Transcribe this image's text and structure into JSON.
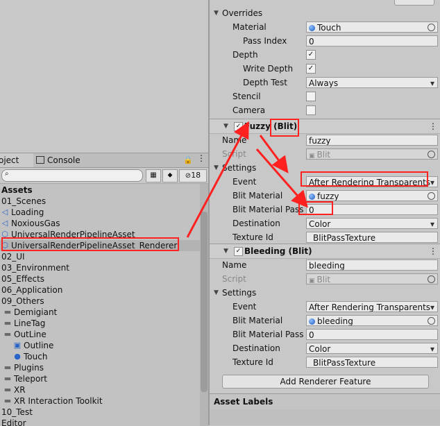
{
  "project": {
    "tabs": [
      {
        "label": "oject"
      },
      {
        "label": "Console"
      }
    ],
    "hidden_count": "18",
    "tree": [
      {
        "label": "Assets",
        "bold": true,
        "icon": "none"
      },
      {
        "label": "01_Scenes",
        "icon": "none"
      },
      {
        "label": "Loading",
        "icon": "unity-scene-icon"
      },
      {
        "label": "NoxiousGas",
        "icon": "unity-scene-icon"
      },
      {
        "label": "UniversalRenderPipelineAsset",
        "icon": "pipeline-asset-icon"
      },
      {
        "label": "UniversalRenderPipelineAsset_Renderer",
        "icon": "pipeline-asset-icon",
        "selected": true
      },
      {
        "label": "02_UI",
        "icon": "none"
      },
      {
        "label": "03_Environment",
        "icon": "none"
      },
      {
        "label": "05_Effects",
        "icon": "none"
      },
      {
        "label": "06_Application",
        "icon": "none"
      },
      {
        "label": "09_Others",
        "icon": "none"
      },
      {
        "label": "Demigiant",
        "icon": "folder-icon"
      },
      {
        "label": "LineTag",
        "icon": "folder-icon"
      },
      {
        "label": "OutLine",
        "icon": "folder-icon"
      },
      {
        "label": "Outline",
        "icon": "script-icon"
      },
      {
        "label": "Touch",
        "icon": "material-icon"
      },
      {
        "label": "Plugins",
        "icon": "folder-icon"
      },
      {
        "label": "Teleport",
        "icon": "folder-icon"
      },
      {
        "label": "XR",
        "icon": "folder-icon"
      },
      {
        "label": "XR Interaction Toolkit",
        "icon": "folder-icon"
      },
      {
        "label": "10_Test",
        "icon": "none"
      },
      {
        "label": "Editor",
        "icon": "none"
      }
    ]
  },
  "inspector": {
    "overrides": {
      "title": "Overrides",
      "material_label": "Material",
      "material_value": "Touch",
      "pass_index_label": "Pass Index",
      "pass_index_value": "0",
      "depth_label": "Depth",
      "write_depth_label": "Write Depth",
      "depth_test_label": "Depth Test",
      "depth_test_value": "Always",
      "stencil_label": "Stencil",
      "camera_label": "Camera"
    },
    "fuzzy": {
      "title": "Fuzzy (Blit)",
      "name_label": "Name",
      "name_value": "fuzzy",
      "script_label": "Script",
      "script_value": "Blit",
      "settings_label": "Settings",
      "event_label": "Event",
      "event_value": "After Rendering Transparents",
      "blit_material_label": "Blit Material",
      "blit_material_value": "fuzzy",
      "pass_label": "Blit Material Pass I",
      "pass_value": "0",
      "destination_label": "Destination",
      "destination_value": "Color",
      "texture_label": "Texture Id",
      "texture_value": "_BlitPassTexture"
    },
    "bleeding": {
      "title": "Bleeding (Blit)",
      "name_label": "Name",
      "name_value": "bleeding",
      "script_label": "Script",
      "script_value": "Blit",
      "settings_label": "Settings",
      "event_label": "Event",
      "event_value": "After Rendering Transparents",
      "blit_material_label": "Blit Material",
      "blit_material_value": "bleeding",
      "pass_label": "Blit Material Pass I",
      "pass_value": "0",
      "destination_label": "Destination",
      "destination_value": "Color",
      "texture_label": "Texture Id",
      "texture_value": "_BlitPassTexture"
    },
    "add_feature_label": "Add Renderer Feature",
    "asset_labels": "Asset Labels"
  },
  "annotation_color": "#ff2020"
}
